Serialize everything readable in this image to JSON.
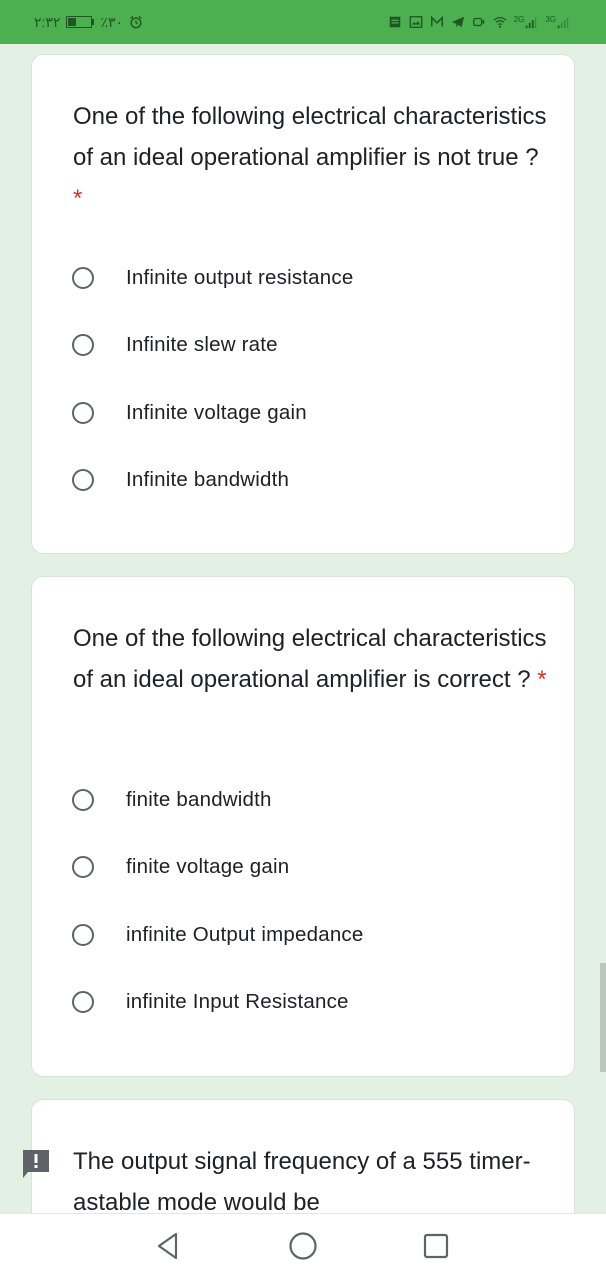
{
  "status_bar": {
    "time": "٢:٣٢",
    "battery_percent_text": "٪٣٠",
    "battery_level": 0.3,
    "left_icons": [
      "battery-icon",
      "alarm-icon"
    ],
    "right_icons": [
      "notes-icon",
      "gallery-icon",
      "gmail-icon",
      "telegram-icon",
      "video-icon",
      "wifi-icon",
      "signal-icon",
      "signal-icon"
    ],
    "signal1_label": "2G",
    "signal2_label": "3G",
    "colors": {
      "bar": "#4caf50",
      "icons": "#1e5722"
    }
  },
  "questions": [
    {
      "text": "One of the following electrical characteristics of an ideal operational amplifier is not true ?",
      "required_mark": "*",
      "options": [
        "Infinite output resistance",
        "Infinite slew rate",
        "Infinite voltage gain",
        "Infinite bandwidth"
      ]
    },
    {
      "text": "One of the following electrical characteristics of an ideal operational amplifier is correct ?",
      "required_mark": "*",
      "options": [
        "finite bandwidth",
        "finite voltage gain",
        "infinite Output impedance",
        "infinite Input Resistance"
      ]
    },
    {
      "text": "The output signal frequency of a 555 timer- astable mode would be",
      "warning_icon": "feedback-exclamation-icon"
    }
  ],
  "nav_bar": {
    "buttons": [
      "back-icon",
      "home-icon",
      "recents-icon"
    ]
  },
  "colors": {
    "background": "#e3f1e4",
    "card": "#ffffff",
    "required": "#d93025",
    "text": "#202124",
    "radio": "#5f6368"
  }
}
